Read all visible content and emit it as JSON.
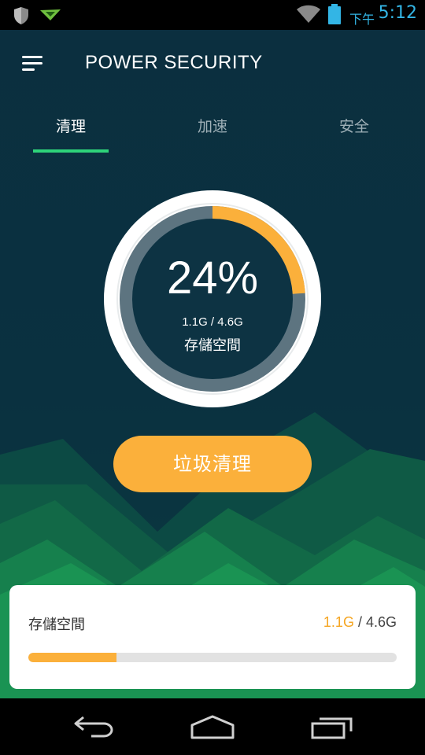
{
  "status_bar": {
    "icons": [
      "shield-icon",
      "airdroid-icon",
      "wifi-icon",
      "battery-icon"
    ],
    "ampm": "下午",
    "time": "5:12",
    "color": "#33b5e5"
  },
  "header": {
    "menu_icon": "hamburger-menu-icon",
    "title": "POWER SECURITY"
  },
  "tabs": [
    {
      "label": "清理",
      "active": true
    },
    {
      "label": "加速",
      "active": false
    },
    {
      "label": "安全",
      "active": false
    }
  ],
  "gauge": {
    "percent_text": "24%",
    "percent": 24,
    "usage_text": "1.1G / 4.6G",
    "label": "存儲空間",
    "accent": "#fbb03b"
  },
  "clean_button": {
    "label": "垃圾清理"
  },
  "storage_card": {
    "label": "存儲空間",
    "used": "1.1G",
    "separator": " / ",
    "total": "4.6G",
    "fraction": 0.24
  },
  "nav_bar": {
    "icons": [
      "back-icon",
      "home-icon",
      "recent-apps-icon"
    ]
  },
  "colors": {
    "background": "#0a2f3e",
    "accent_green": "#2ed37a",
    "accent_orange": "#fbb03b"
  }
}
